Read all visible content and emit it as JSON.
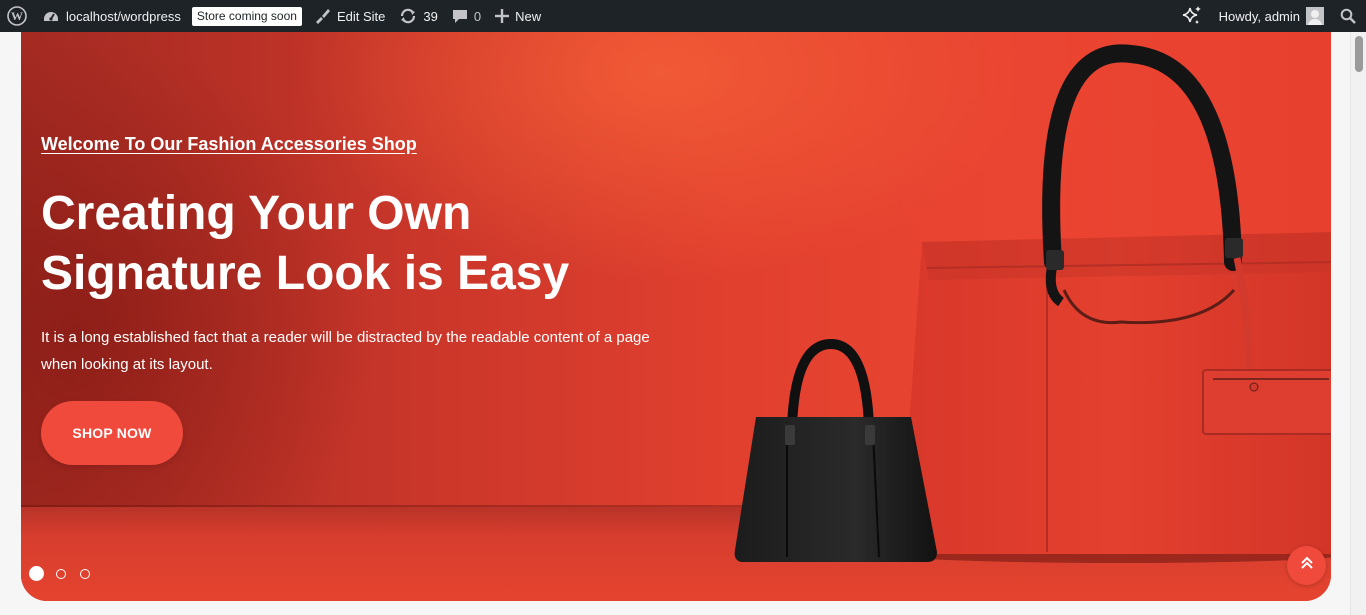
{
  "adminbar": {
    "site_url": "localhost/wordpress",
    "store_badge": "Store coming soon",
    "edit_site": "Edit Site",
    "updates_count": "39",
    "comments_count": "0",
    "new_label": "New",
    "howdy": "Howdy, admin",
    "icons": [
      "wordpress-logo-icon",
      "dashboard-icon",
      "brush-icon",
      "updates-icon",
      "comment-icon",
      "plus-icon",
      "sparkle-icon",
      "search-icon"
    ]
  },
  "hero": {
    "welcome": "Welcome To Our Fashion Accessories Shop",
    "headline_line1": "Creating Your Own",
    "headline_line2": "Signature Look is Easy",
    "description": "It is a long established fact that a reader will be distracted by the readable content of a page when looking at its layout.",
    "cta_label": "SHOP NOW",
    "slides_total": 3,
    "active_slide": 1,
    "accent_color": "#ef4a3c"
  }
}
